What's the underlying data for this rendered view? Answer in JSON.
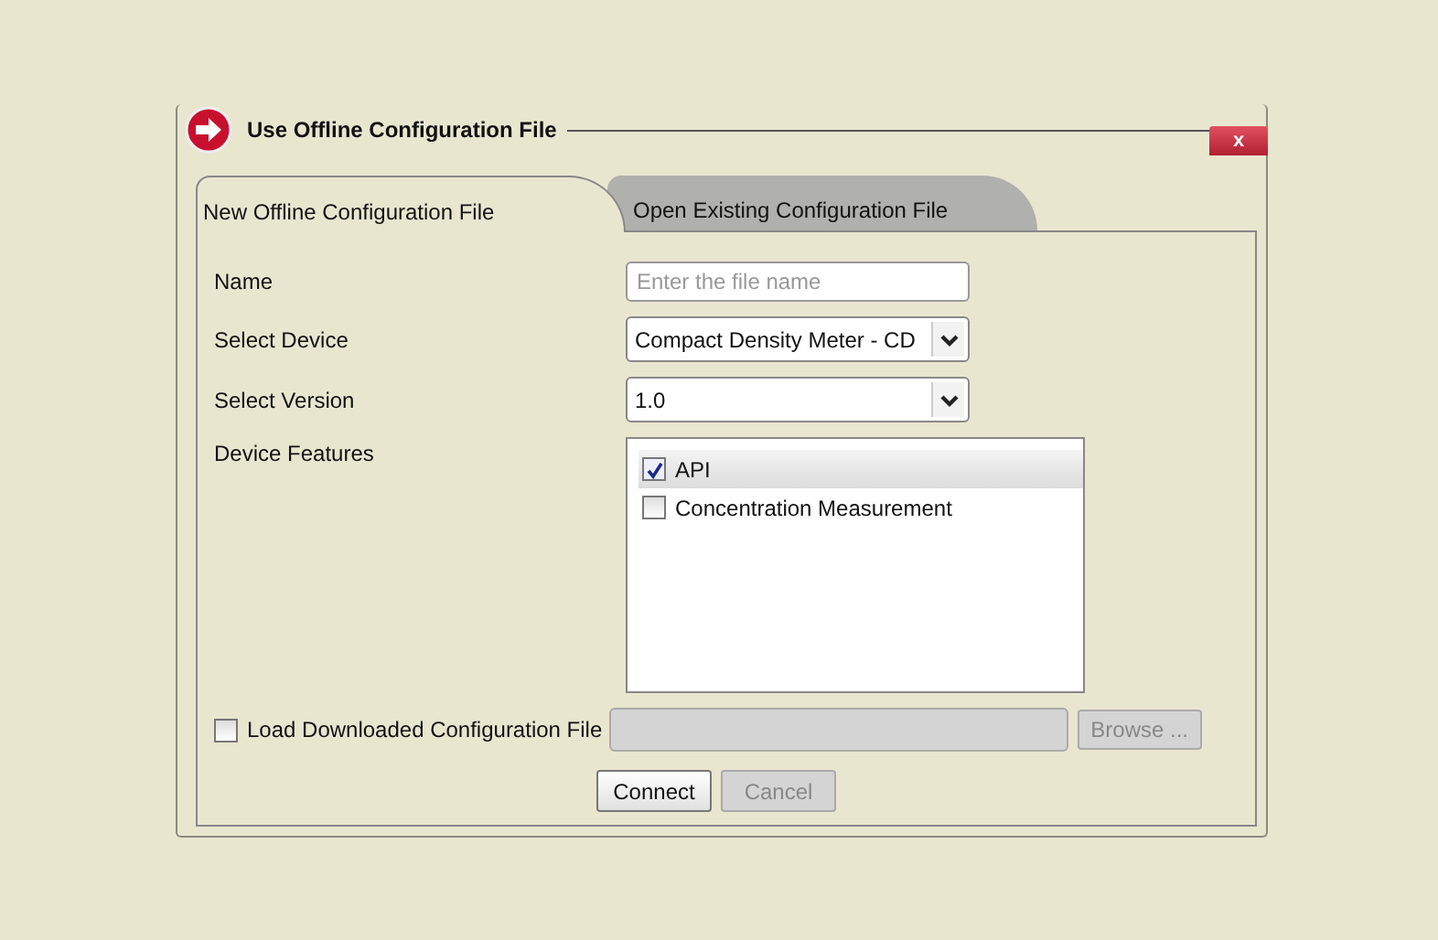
{
  "dialog": {
    "title": "Use Offline Configuration File",
    "close": "x"
  },
  "tabs": [
    {
      "label": "New Offline Configuration File",
      "selected": true
    },
    {
      "label": "Open Existing Configuration File",
      "selected": false
    }
  ],
  "form": {
    "name_label": "Name",
    "name_placeholder": "Enter the file name",
    "device_label": "Select Device",
    "device_value": "Compact Density Meter - CD",
    "version_label": "Select Version",
    "version_value": "1.0",
    "features_label": "Device Features",
    "features": [
      {
        "label": "API",
        "checked": true,
        "selected": true
      },
      {
        "label": "Concentration Measurement",
        "checked": false,
        "selected": false
      }
    ],
    "load": {
      "label": "Load Downloaded Configuration File",
      "checked": false,
      "disabled": true
    },
    "browse": {
      "label": "Browse ...",
      "disabled": true
    }
  },
  "buttons": [
    {
      "label": "Connect",
      "disabled": false
    },
    {
      "label": "Cancel",
      "disabled": true
    }
  ]
}
